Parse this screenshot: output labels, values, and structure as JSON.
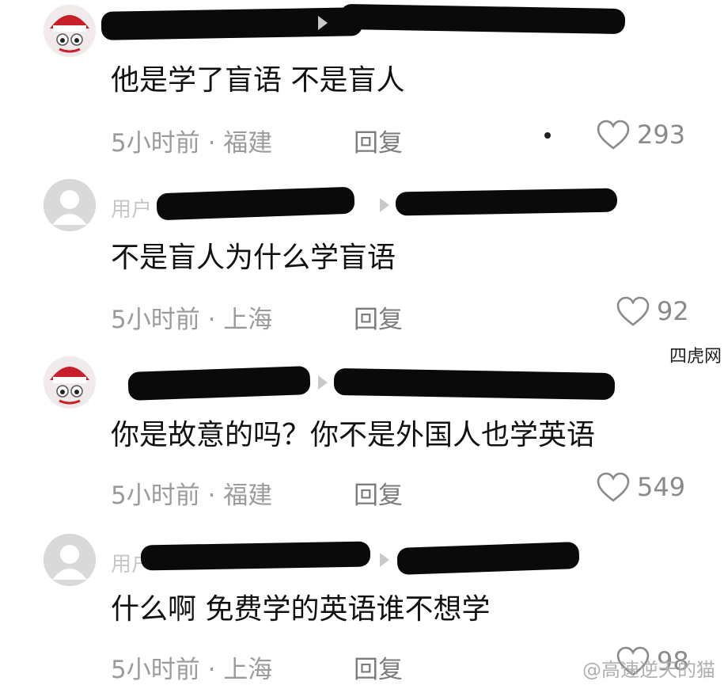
{
  "side_label": "四虎网",
  "watermark": "@高速逆天的猫",
  "comments": [
    {
      "text": "他是学了盲语 不是盲人",
      "name_hint": "",
      "meta": "5小时前 · 福建",
      "reply": "回复",
      "likes": "293",
      "avatar": "photo"
    },
    {
      "text": "不是盲人为什么学盲语",
      "name_hint": "用户",
      "meta": "5小时前 · 上海",
      "reply": "回复",
      "likes": "92",
      "avatar": "default"
    },
    {
      "text": "你是故意的吗？你不是外国人也学英语",
      "name_hint": "",
      "meta": "5小时前 · 福建",
      "reply": "回复",
      "likes": "549",
      "avatar": "photo"
    },
    {
      "text": "什么啊 免费学的英语谁不想学",
      "name_hint": "用户",
      "meta": "5小时前 · 上海",
      "reply": "回复",
      "likes": "98",
      "avatar": "default"
    }
  ],
  "icons": {
    "like": "heart-icon",
    "avatar_default": "default-avatar-icon",
    "reply_arrow": "triangle-right-icon"
  }
}
